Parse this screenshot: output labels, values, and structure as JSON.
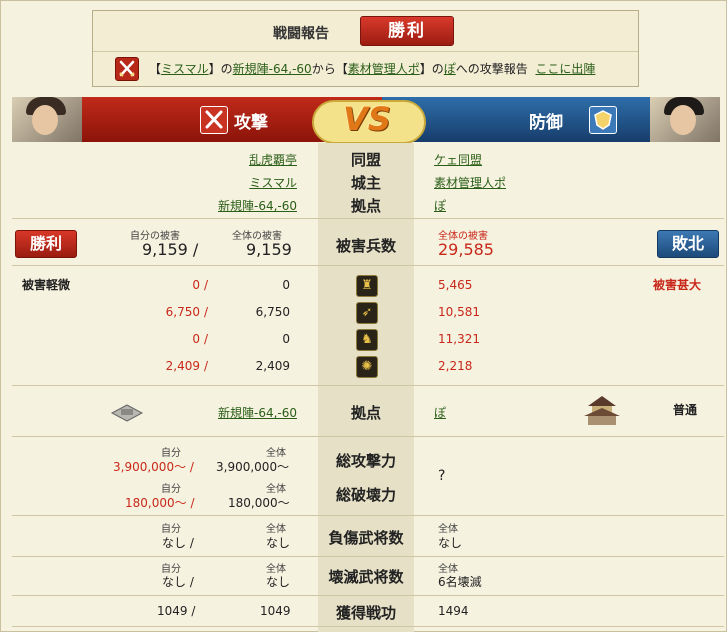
{
  "report": {
    "title": "戦闘報告",
    "result": "勝利",
    "line": {
      "bracket_open": "【",
      "attacker_name": "ミスマル",
      "bracket_close_of": "】の",
      "attacker_base": "新規陣-64,-60",
      "from_text": "から【",
      "defender_name": "素材管理人ポ",
      "defender_suffix": "】の",
      "defender_base": "ぽ",
      "attack_report_text": "への攻撃報告",
      "deploy_link": "ここに出陣"
    }
  },
  "banner": {
    "attack_label": "攻撃",
    "vs_label": "VS",
    "defense_label": "防御"
  },
  "rows": {
    "alliance": {
      "label": "同盟",
      "attacker": "乱虎覇亭",
      "defender": "ケェ同盟"
    },
    "lord": {
      "label": "城主",
      "attacker": "ミスマル",
      "defender": "素材管理人ポ"
    },
    "base": {
      "label": "拠点",
      "attacker": "新規陣-64,-60",
      "defender": "ぽ"
    }
  },
  "casualties": {
    "label": "被害兵数",
    "win_stamp": "勝利",
    "lose_stamp": "敗北",
    "own_loss_label": "自分の被害",
    "total_loss_label": "全体の被害",
    "attacker_own": "9,159",
    "attacker_total": "9,159",
    "defender_total_label": "全体の被害",
    "defender_total": "29,585",
    "slash": "/"
  },
  "damage": {
    "attacker_level": "被害軽微",
    "defender_level": "被害甚大"
  },
  "units": [
    {
      "icon": "spearman-icon",
      "glyph": "♜",
      "own": "0",
      "total": "0",
      "defender": "5,465"
    },
    {
      "icon": "bow-icon",
      "glyph": "➶",
      "own": "6,750",
      "total": "6,750",
      "defender": "10,581"
    },
    {
      "icon": "horse-icon",
      "glyph": "♞",
      "own": "0",
      "total": "0",
      "defender": "11,321"
    },
    {
      "icon": "siege-icon",
      "glyph": "✺",
      "own": "2,409",
      "total": "2,409",
      "defender": "2,218"
    }
  ],
  "base_row": {
    "label": "拠点",
    "attacker": "新規陣-64,-60",
    "defender": "ぽ",
    "defender_status": "普通"
  },
  "power": {
    "attack_label": "総攻撃力",
    "destroy_label": "総破壊力",
    "self_label": "自分",
    "all_label": "全体",
    "attack_own": "3,900,000〜",
    "attack_total": "3,900,000〜",
    "destroy_own": "180,000〜",
    "destroy_total": "180,000〜",
    "defender_value": "?"
  },
  "injured": {
    "label": "負傷武将数",
    "self_label": "自分",
    "all_label": "全体",
    "own": "なし",
    "total": "なし",
    "defender_label": "全体",
    "defender": "なし"
  },
  "destroyed": {
    "label": "壊滅武将数",
    "self_label": "自分",
    "all_label": "全体",
    "own": "なし",
    "total": "なし",
    "defender_label": "全体",
    "defender": "6名壊滅"
  },
  "merit": {
    "label": "獲得戦功",
    "own": "1049",
    "total": "1049",
    "defender": "1494"
  },
  "colors": {
    "attack_red": "#c02a1a",
    "defense_blue": "#2e6eaa",
    "link_green": "#2a5e17",
    "loss_red": "#c8281a",
    "center_column": "#e6e0c6"
  }
}
